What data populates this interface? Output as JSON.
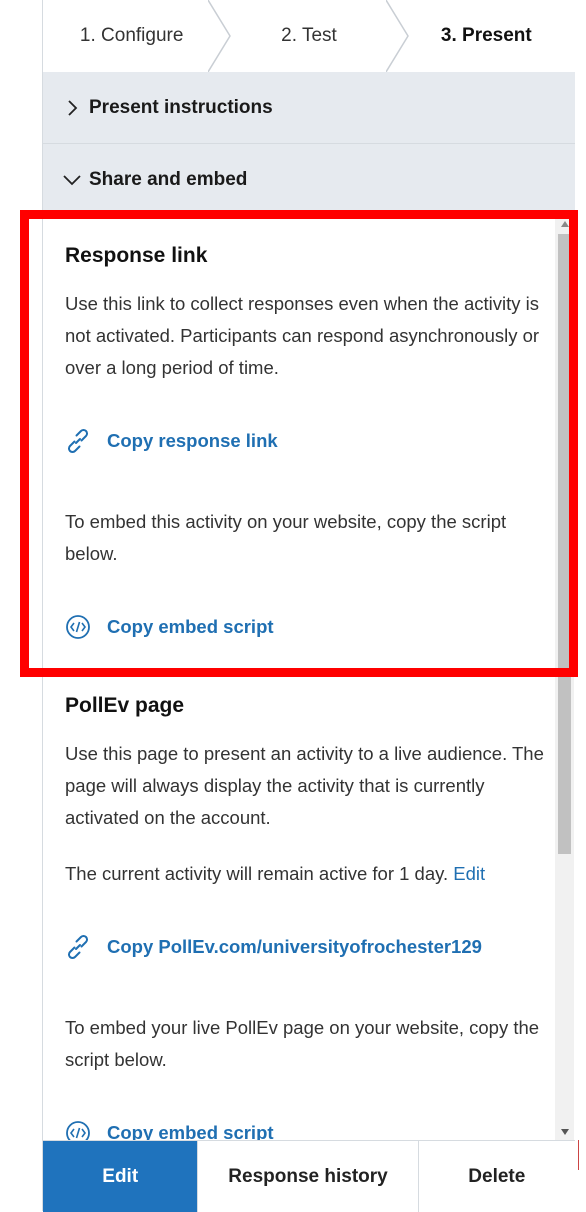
{
  "steps": [
    {
      "label": "1. Configure"
    },
    {
      "label": "2. Test"
    },
    {
      "label": "3. Present"
    }
  ],
  "accordions": {
    "present_instructions": "Present instructions",
    "share_and_embed": "Share and embed"
  },
  "response_link": {
    "title": "Response link",
    "description": "Use this link to collect responses even when the activity is not activated. Participants can respond asynchronously or over a long period of time.",
    "copy_link_label": "Copy response link",
    "embed_text": "To embed this activity on your website, copy the script below.",
    "copy_embed_label": "Copy embed script"
  },
  "pollev_page": {
    "title": "PollEv page",
    "description": "Use this page to present an activity to a live audience. The page will always display the activity that is currently activated on the account.",
    "active_text": "The current activity will remain active for 1 day.",
    "edit_label": "Edit",
    "copy_link_label": "Copy PollEv.com/universityofrochester129",
    "embed_text": "To embed your live PollEv page on your website, copy the script below.",
    "copy_embed_label": "Copy embed script"
  },
  "footer": {
    "edit_label": "Edit",
    "history_label": "Response history",
    "delete_label": "Delete"
  },
  "colors": {
    "accent": "#1f73bd",
    "link": "#1f6fb2",
    "highlight": "#ff0000",
    "accordion_bg": "#e6eaef"
  },
  "icons": [
    "chevron-right-icon",
    "chevron-down-icon",
    "link-icon",
    "code-icon"
  ]
}
